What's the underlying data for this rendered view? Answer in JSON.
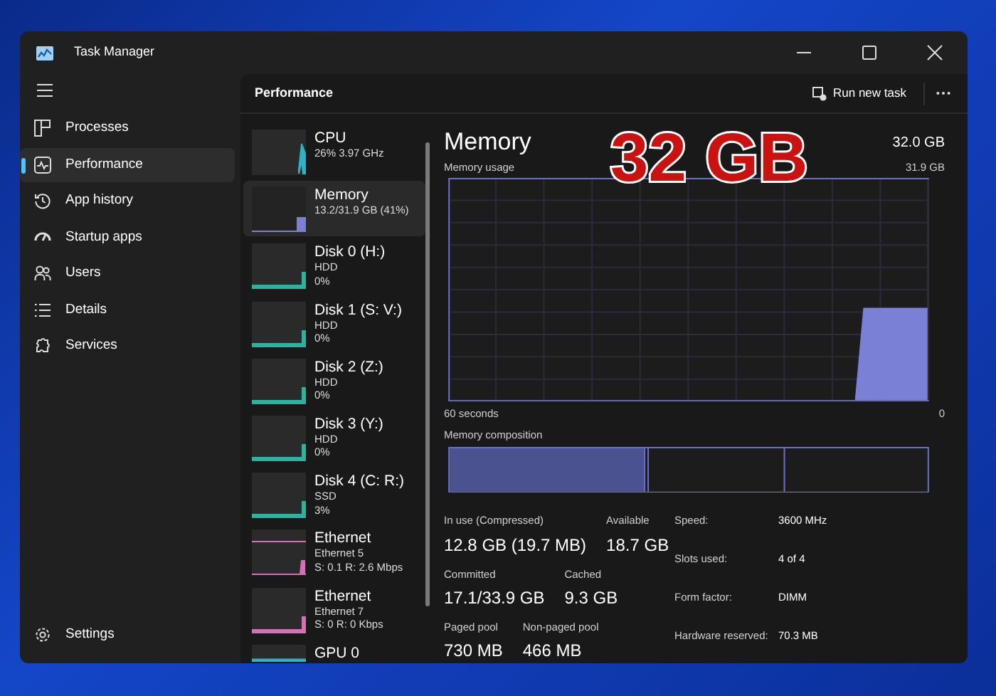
{
  "window": {
    "title": "Task Manager"
  },
  "sidebar": {
    "items": [
      {
        "label": "Processes",
        "kind": "processes",
        "selected": false
      },
      {
        "label": "Performance",
        "kind": "performance",
        "selected": true
      },
      {
        "label": "App history",
        "kind": "history",
        "selected": false
      },
      {
        "label": "Startup apps",
        "kind": "startup",
        "selected": false
      },
      {
        "label": "Users",
        "kind": "users",
        "selected": false
      },
      {
        "label": "Details",
        "kind": "details",
        "selected": false
      },
      {
        "label": "Services",
        "kind": "services",
        "selected": false
      }
    ],
    "settings": "Settings"
  },
  "header": {
    "title": "Performance",
    "run_new_task": "Run new task"
  },
  "devices": [
    {
      "name": "CPU",
      "lines": [
        "26% 3.97 GHz"
      ],
      "color": "#2bb3c7",
      "selected": false
    },
    {
      "name": "Memory",
      "lines": [
        "13.2/31.9 GB (41%)"
      ],
      "color": "#7a80d6",
      "selected": true
    },
    {
      "name": "Disk 0 (H:)",
      "lines": [
        "HDD",
        "0%"
      ],
      "color": "#2bb3a0",
      "selected": false
    },
    {
      "name": "Disk 1 (S: V:)",
      "lines": [
        "HDD",
        "0%"
      ],
      "color": "#2bb3a0",
      "selected": false
    },
    {
      "name": "Disk 2 (Z:)",
      "lines": [
        "HDD",
        "0%"
      ],
      "color": "#2bb3a0",
      "selected": false
    },
    {
      "name": "Disk 3 (Y:)",
      "lines": [
        "HDD",
        "0%"
      ],
      "color": "#2bb3a0",
      "selected": false
    },
    {
      "name": "Disk 4 (C: R:)",
      "lines": [
        "SSD",
        "3%"
      ],
      "color": "#2bb3a0",
      "selected": false
    },
    {
      "name": "Ethernet",
      "lines": [
        "Ethernet 5",
        "S: 0.1 R: 2.6 Mbps"
      ],
      "color": "#d46fb8",
      "selected": false
    },
    {
      "name": "Ethernet",
      "lines": [
        "Ethernet 7",
        "S: 0 R: 0 Kbps"
      ],
      "color": "#d46fb8",
      "selected": false
    },
    {
      "name": "GPU 0",
      "color": "#2bb3c7",
      "selected": false
    }
  ],
  "detail": {
    "title": "Memory",
    "total": "32.0 GB",
    "usage_label": "Memory usage",
    "usage_max": "31.9 GB",
    "x_start": "60 seconds",
    "x_end": "0",
    "composition_label": "Memory composition",
    "stats": [
      [
        {
          "label": "In use (Compressed)",
          "value": "12.8 GB (19.7 MB)"
        },
        {
          "label": "Available",
          "value": "18.7 GB"
        }
      ],
      [
        {
          "label": "Committed",
          "value": "17.1/33.9 GB"
        },
        {
          "label": "Cached",
          "value": "9.3 GB"
        }
      ],
      [
        {
          "label": "Paged pool",
          "value": "730 MB"
        },
        {
          "label": "Non-paged pool",
          "value": "466 MB"
        }
      ]
    ],
    "specs": [
      {
        "label": "Speed:",
        "value": "3600 MHz"
      },
      {
        "label": "Slots used:",
        "value": "4 of 4"
      },
      {
        "label": "Form factor:",
        "value": "DIMM"
      },
      {
        "label": "Hardware reserved:",
        "value": "70.3 MB"
      }
    ]
  },
  "annotation": "32 GB"
}
